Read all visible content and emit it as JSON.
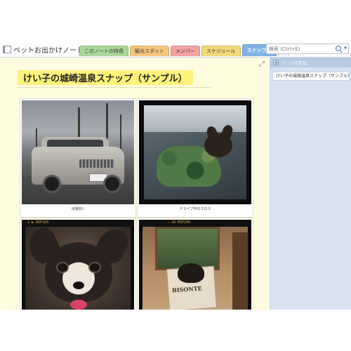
{
  "notebook": {
    "name": "ペットお出かけノート",
    "caret": "▼"
  },
  "tabs": [
    {
      "label": "このノートの特長",
      "color": "#a8d898",
      "active": false
    },
    {
      "label": "観光スポット",
      "color": "#f5c77e",
      "active": false
    },
    {
      "label": "メンバー",
      "color": "#f4a3a3",
      "active": false
    },
    {
      "label": "スケジュール",
      "color": "#f2d97a",
      "active": false
    },
    {
      "label": "スナップ集",
      "color": "#7fb3e3",
      "active": true
    },
    {
      "label": "+",
      "color": "#f3f3f3",
      "active": false
    }
  ],
  "search": {
    "placeholder": "検索 (Ctrl+E)"
  },
  "page": {
    "title": "けい子の城崎温泉スナップ（サンプル）",
    "expand_icon": "⤢",
    "photos": [
      {
        "caption": "出発前♪",
        "icon": "car-photo"
      },
      {
        "caption": "ドライブ中のクロス",
        "icon": "dog-in-car-photo"
      },
      {
        "caption": "",
        "icon": "dog-closeup-photo",
        "film_label": "2 ▶ RVP100"
      },
      {
        "caption": "",
        "icon": "dog-in-bag-photo",
        "film_label": "→ 2A RVP100",
        "bag_text": "BISONTE"
      }
    ]
  },
  "right_pane": {
    "add_page_label": "ページの追加",
    "pages": [
      {
        "label": "けい子の城崎温泉スナップ（サンプル）"
      }
    ]
  },
  "colors": {
    "page_bg": "#fffde0",
    "title_highlight": "#fff27a",
    "right_pane_bg": "#d8e3f2",
    "add_page_bar": "#b8cbe6"
  }
}
